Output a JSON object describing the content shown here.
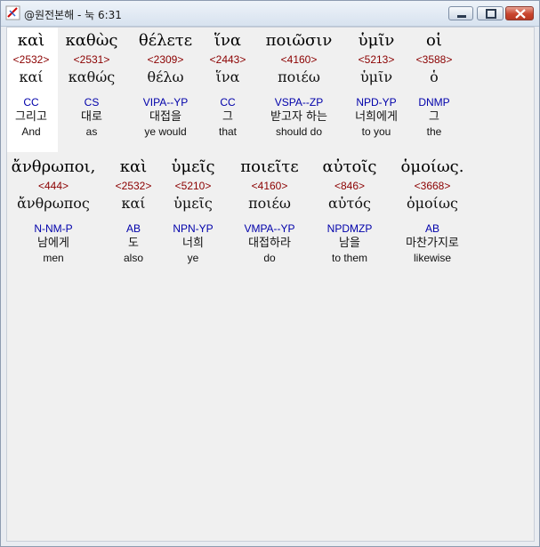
{
  "window": {
    "title": "@원전본해 - 눅 6:31"
  },
  "rows": [
    {
      "words": [
        {
          "greek": "καὶ",
          "strong": "<2532>",
          "lemma": "καί",
          "morph": "CC",
          "korean": "그리고",
          "english": "And"
        },
        {
          "greek": "καθὼς",
          "strong": "<2531>",
          "lemma": "καθώς",
          "morph": "CS",
          "korean": "대로",
          "english": "as"
        },
        {
          "greek": "θέλετε",
          "strong": "<2309>",
          "lemma": "θέλω",
          "morph": "VIPA--YP",
          "korean": "대접을",
          "english": "ye would"
        },
        {
          "greek": "ἵνα",
          "strong": "<2443>",
          "lemma": "ἵνα",
          "morph": "CC",
          "korean": "그",
          "english": "that"
        },
        {
          "greek": "ποιῶσιν",
          "strong": "<4160>",
          "lemma": "ποιέω",
          "morph": "VSPA--ZP",
          "korean": "받고자 하는",
          "english": "should do"
        },
        {
          "greek": "ὑμῖν",
          "strong": "<5213>",
          "lemma": "ὑμῖν",
          "morph": "NPD-YP",
          "korean": "너희에게",
          "english": "to you"
        },
        {
          "greek": "οἱ",
          "strong": "<3588>",
          "lemma": "ὁ",
          "morph": "DNMP",
          "korean": "그",
          "english": "the"
        }
      ]
    },
    {
      "words": [
        {
          "greek": "ἄνθρωποι,",
          "strong": "<444>",
          "lemma": "ἄνθρωπος",
          "morph": "N-NM-P",
          "korean": "남에게",
          "english": "men"
        },
        {
          "greek": "καὶ",
          "strong": "<2532>",
          "lemma": "καί",
          "morph": "AB",
          "korean": "도",
          "english": "also"
        },
        {
          "greek": "ὑμεῖς",
          "strong": "<5210>",
          "lemma": "ὑμεῖς",
          "morph": "NPN-YP",
          "korean": "너희",
          "english": "ye"
        },
        {
          "greek": "ποιεῖτε",
          "strong": "<4160>",
          "lemma": "ποιέω",
          "morph": "VMPA--YP",
          "korean": "대접하라",
          "english": "do"
        },
        {
          "greek": "αὐτοῖς",
          "strong": "<846>",
          "lemma": "αὐτός",
          "morph": "NPDMZP",
          "korean": "남을",
          "english": "to them"
        },
        {
          "greek": "ὁμοίως.",
          "strong": "<3668>",
          "lemma": "ὁμοίως",
          "morph": "AB",
          "korean": "마찬가지로",
          "english": "likewise"
        }
      ]
    }
  ]
}
